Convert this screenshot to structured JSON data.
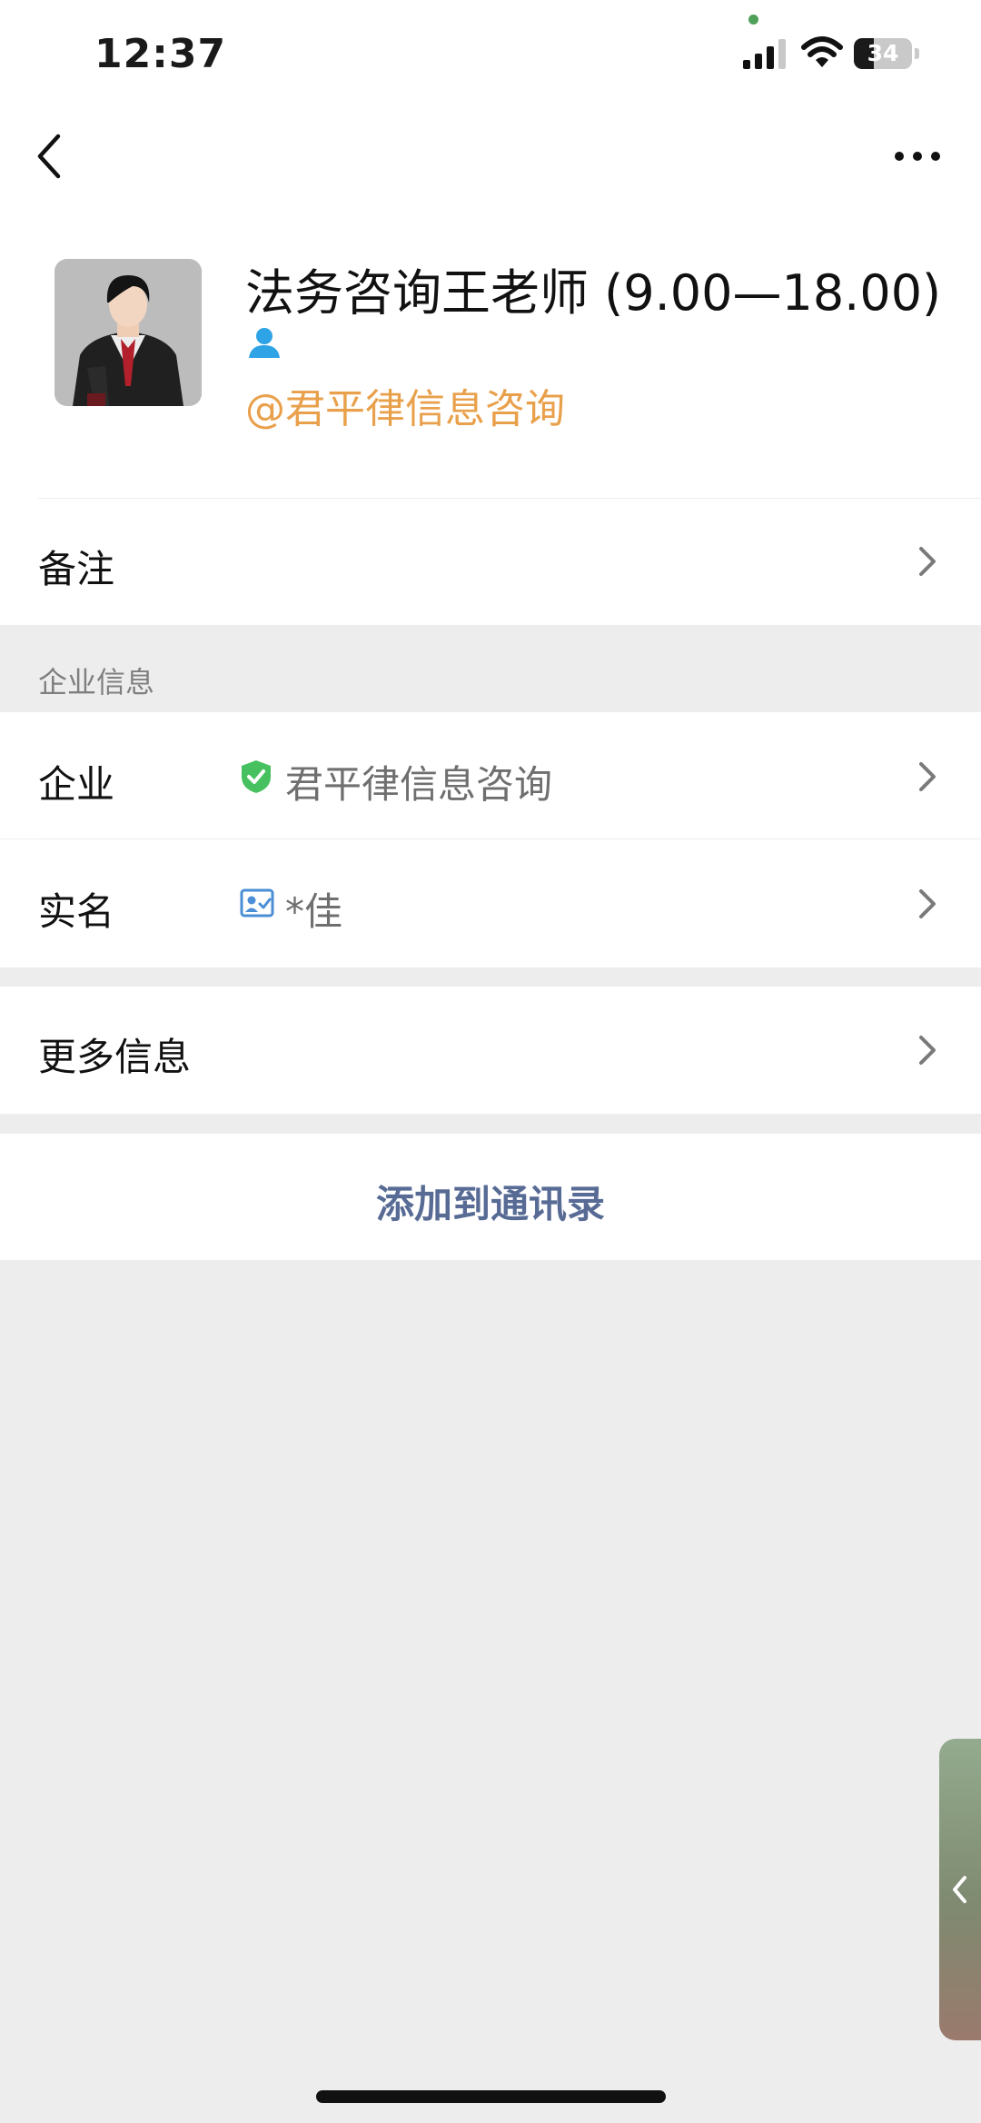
{
  "status_bar": {
    "time": "12:37",
    "battery": "34",
    "battery_level": 0.34
  },
  "profile": {
    "name": "法务咨询王老师 (9.00—18.00)",
    "org_tag": "@君平律信息咨询"
  },
  "rows": {
    "remark": {
      "label": "备注"
    },
    "section_title": "企业信息",
    "company": {
      "label": "企业",
      "value": "君平律信息咨询"
    },
    "real_name": {
      "label": "实名",
      "value": "*佳"
    },
    "more_info": {
      "label": "更多信息"
    }
  },
  "action": {
    "add_to_contacts": "添加到通讯录"
  },
  "colors": {
    "accent_link": "#576b95",
    "org_tag": "#e9a04b",
    "verified": "#47c15f"
  },
  "icons": [
    "chevron-left-icon",
    "more-icon",
    "person-icon",
    "verified-shield-icon",
    "id-card-icon",
    "chevron-right-icon"
  ]
}
